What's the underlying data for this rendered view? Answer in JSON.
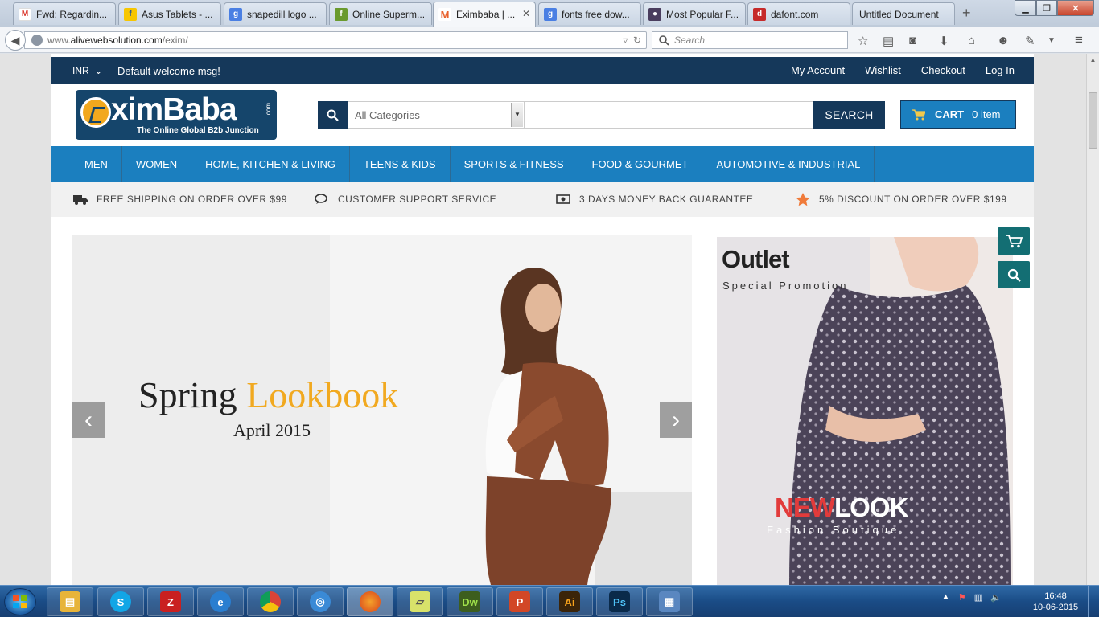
{
  "browser": {
    "tabs": [
      {
        "label": "Fwd: Regardin...",
        "icon": "gmail-icon",
        "color": "#d93025",
        "glyph": "M"
      },
      {
        "label": "Asus Tablets - ...",
        "icon": "flipkart-icon",
        "color": "#f7c600",
        "glyph": "f"
      },
      {
        "label": "snapedill logo ...",
        "icon": "google-icon",
        "color": "#4a7fe3",
        "glyph": "g"
      },
      {
        "label": "Online Superm...",
        "icon": "site-icon",
        "color": "#6a9a2d",
        "glyph": "f"
      },
      {
        "label": "Eximbaba | ...",
        "icon": "magento-icon",
        "color": "#e8612c",
        "glyph": "M"
      },
      {
        "label": "fonts free dow...",
        "icon": "google-icon",
        "color": "#4a7fe3",
        "glyph": "g"
      },
      {
        "label": "Most Popular F...",
        "icon": "fontsite-icon",
        "color": "#4a3d5e",
        "glyph": "●"
      },
      {
        "label": "dafont.com",
        "icon": "dafont-icon",
        "color": "#c62a2a",
        "glyph": "d"
      },
      {
        "label": "Untitled Document",
        "icon": "",
        "color": "",
        "glyph": ""
      }
    ],
    "new_tab": "+",
    "url_prefix": "www.",
    "url_domain": "alivewebsolution.com",
    "url_path": "/exim/",
    "search_placeholder": "Search"
  },
  "site": {
    "currency": "INR",
    "welcome": "Default welcome msg!",
    "top_links": [
      "My Account",
      "Wishlist",
      "Checkout",
      "Log In"
    ],
    "logo": {
      "brand": "ximBaba",
      "dotcom": ".com",
      "tagline": "The Online Global B2b Junction"
    },
    "search": {
      "category": "All Categories",
      "button": "SEARCH"
    },
    "cart": {
      "label": "CART",
      "count": "0 item"
    },
    "nav": [
      "MEN",
      "WOMEN",
      "HOME, KITCHEN & LIVING",
      "TEENS & KIDS",
      "SPORTS & FITNESS",
      "FOOD & GOURMET",
      "AUTOMOTIVE & INDUSTRIAL"
    ],
    "benefits": [
      "FREE SHIPPING ON ORDER OVER $99",
      "CUSTOMER SUPPORT SERVICE",
      "3 DAYS MONEY BACK GUARANTEE",
      "5% DISCOUNT ON ORDER OVER $199"
    ],
    "slide": {
      "title_a": "Spring",
      "title_b": "Lookbook",
      "subtitle": "April 2015"
    },
    "promo": {
      "title": "Outlet",
      "subtitle": "Special Promotion",
      "brand_a": "NEW",
      "brand_b": "LOOK",
      "brand_sub": "Fashion Boutique"
    }
  },
  "taskbar": {
    "apps": [
      {
        "name": "explorer",
        "glyph": "▤",
        "color": "#e7b43a"
      },
      {
        "name": "skype",
        "glyph": "S",
        "color": "#12a6e6"
      },
      {
        "name": "filezilla",
        "glyph": "Z",
        "color": "#c92020"
      },
      {
        "name": "internet-explorer",
        "glyph": "e",
        "color": "#2a7ed0"
      },
      {
        "name": "chrome",
        "glyph": "●",
        "color": "#4a9d3a"
      },
      {
        "name": "safari",
        "glyph": "◎",
        "color": "#3a8ad6"
      },
      {
        "name": "firefox",
        "glyph": "●",
        "color": "#e4661b"
      },
      {
        "name": "sticky-notes",
        "glyph": "▱",
        "color": "#d8e26a"
      },
      {
        "name": "dreamweaver",
        "glyph": "Dw",
        "color": "#3d5e1e"
      },
      {
        "name": "powerpoint",
        "glyph": "P",
        "color": "#d24726"
      },
      {
        "name": "illustrator",
        "glyph": "Ai",
        "color": "#3b2409"
      },
      {
        "name": "photoshop",
        "glyph": "Ps",
        "color": "#0a2a4a"
      },
      {
        "name": "control-panel",
        "glyph": "▦",
        "color": "#5a87c0"
      }
    ],
    "time": "16:48",
    "date": "10-06-2015"
  }
}
